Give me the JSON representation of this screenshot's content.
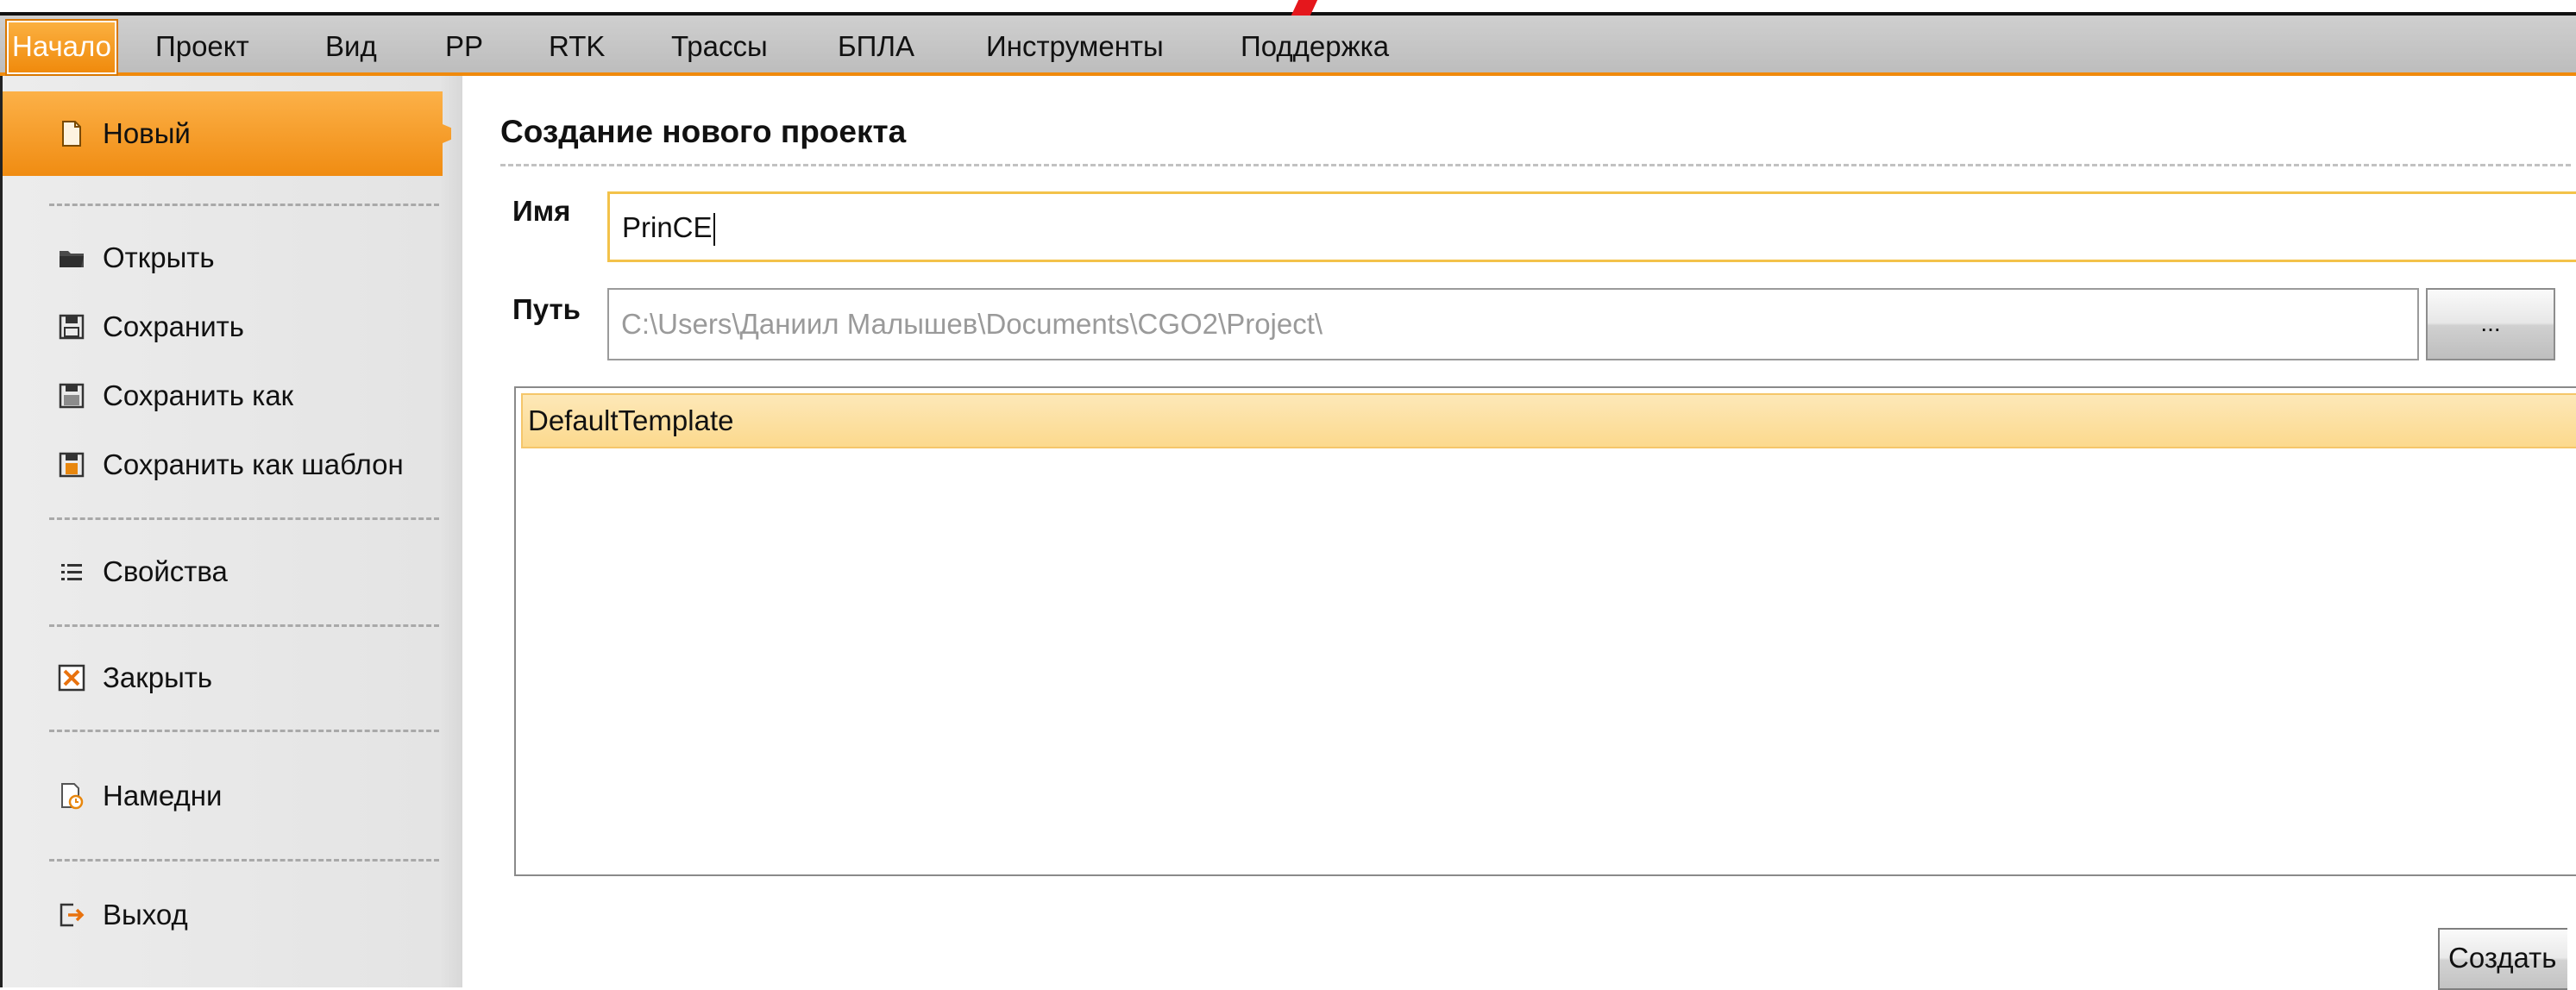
{
  "menubar": {
    "items": [
      {
        "label": "Начало",
        "active": true
      },
      {
        "label": "Проект"
      },
      {
        "label": "Вид"
      },
      {
        "label": "PP"
      },
      {
        "label": "RTK"
      },
      {
        "label": "Трассы"
      },
      {
        "label": "БПЛА"
      },
      {
        "label": "Инструменты"
      },
      {
        "label": "Поддержка"
      }
    ]
  },
  "sidebar": {
    "items": [
      {
        "label": "Новый",
        "icon": "new-file-icon",
        "active": true
      },
      {
        "label": "Открыть",
        "icon": "open-folder-icon"
      },
      {
        "label": "Сохранить",
        "icon": "save-icon"
      },
      {
        "label": "Сохранить как",
        "icon": "save-as-icon"
      },
      {
        "label": "Сохранить как шаблон",
        "icon": "save-as-template-icon"
      },
      {
        "label": "Свойства",
        "icon": "properties-icon"
      },
      {
        "label": "Закрыть",
        "icon": "close-project-icon"
      },
      {
        "label": "Намедни",
        "icon": "recent-icon"
      },
      {
        "label": "Выход",
        "icon": "exit-icon"
      }
    ]
  },
  "main": {
    "title": "Создание нового проекта",
    "name_label": "Имя",
    "name_value": "PrinCE",
    "path_label": "Путь",
    "path_placeholder": "C:\\Users\\Даниил Малышев\\Documents\\CGO2\\Project\\",
    "browse_label": "...",
    "templates": [
      "DefaultTemplate"
    ],
    "create_label": "Создать"
  },
  "colors": {
    "accent": "#f08a0c",
    "selection": "#fcd98d",
    "annotation": "#e5171c"
  }
}
